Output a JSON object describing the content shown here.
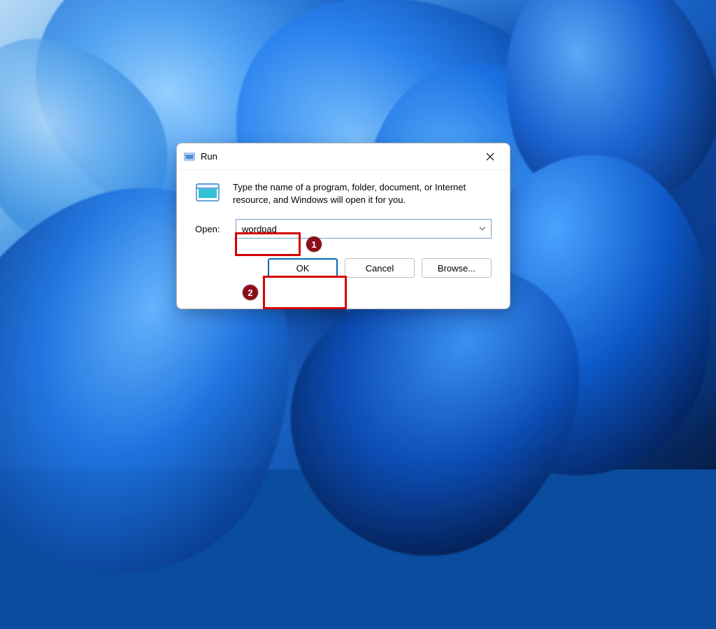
{
  "dialog": {
    "title": "Run",
    "description": "Type the name of a program, folder, document, or Internet resource, and Windows will open it for you.",
    "open_label": "Open:",
    "input_value": "wordpad",
    "buttons": {
      "ok": "OK",
      "cancel": "Cancel",
      "browse": "Browse..."
    }
  },
  "annotations": {
    "step1": "1",
    "step2": "2"
  }
}
